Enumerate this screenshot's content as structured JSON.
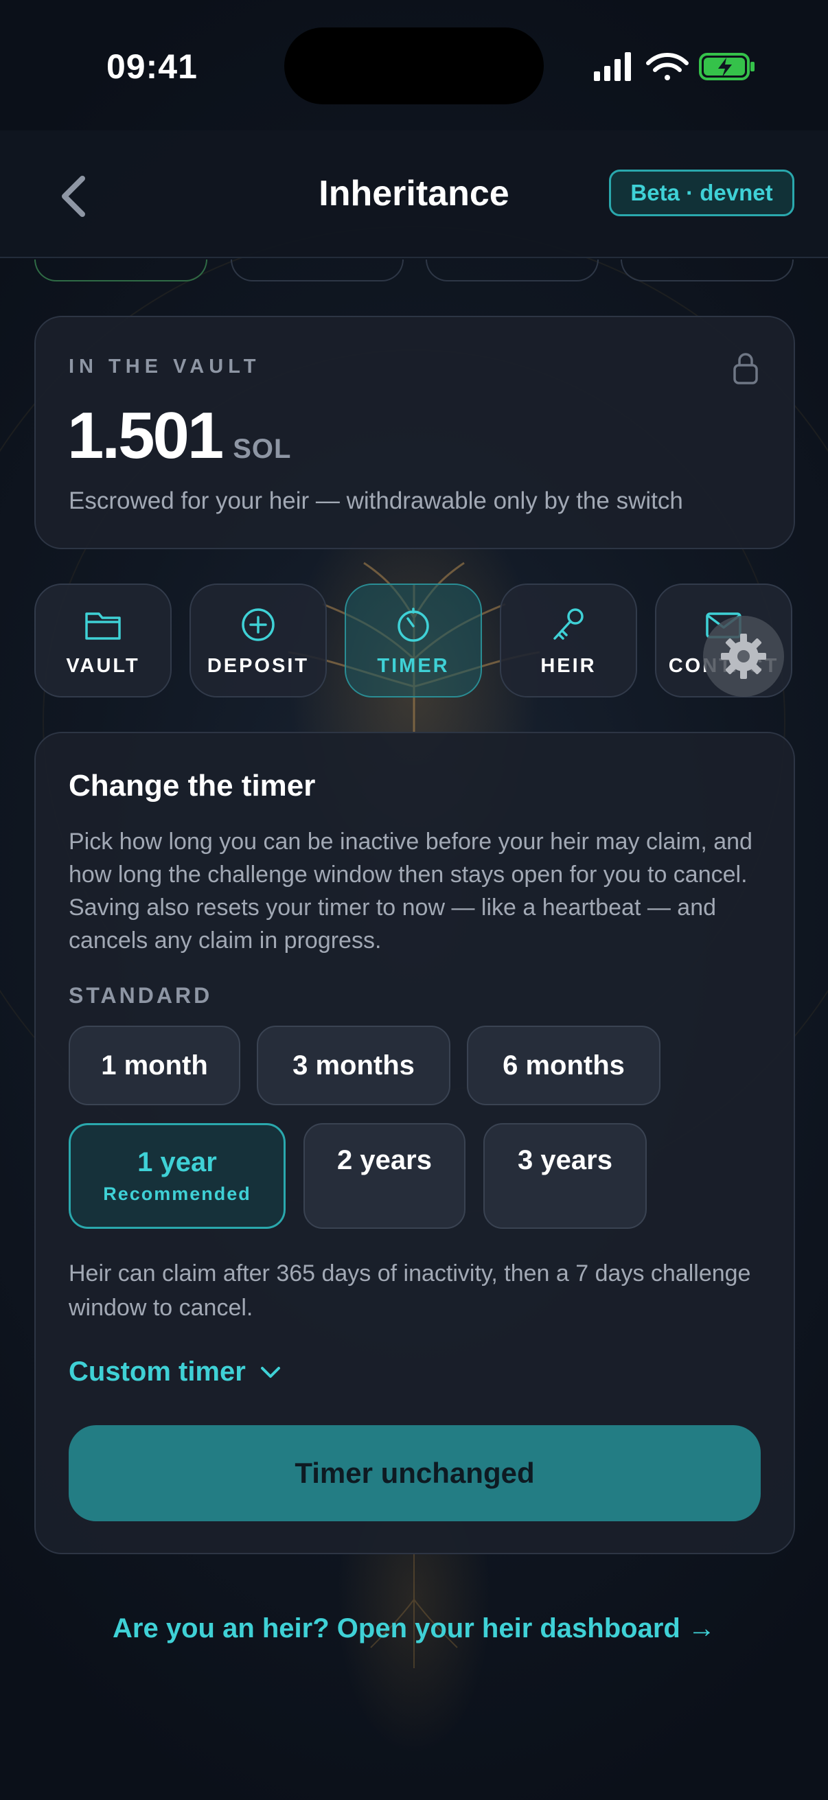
{
  "status_bar": {
    "time": "09:41"
  },
  "header": {
    "title": "Inheritance",
    "badge": "Beta · devnet"
  },
  "vault": {
    "kicker": "IN THE VAULT",
    "amount": "1.501",
    "unit": "SOL",
    "description": "Escrowed for your heir — withdrawable only by the switch"
  },
  "nav": {
    "items": [
      {
        "label": "VAULT",
        "icon": "folder-icon"
      },
      {
        "label": "DEPOSIT",
        "icon": "plus-circle-icon"
      },
      {
        "label": "TIMER",
        "icon": "timer-icon",
        "active": true
      },
      {
        "label": "HEIR",
        "icon": "key-icon"
      },
      {
        "label": "CONTACT",
        "icon": "mail-icon"
      }
    ]
  },
  "timer": {
    "title": "Change the timer",
    "description": "Pick how long you can be inactive before your heir may claim, and how long the challenge window then stays open for you to cancel. Saving also resets your timer to now — like a heartbeat — and cancels any claim in progress.",
    "section_label": "STANDARD",
    "options": [
      {
        "label": "1 month"
      },
      {
        "label": "3 months"
      },
      {
        "label": "6 months"
      },
      {
        "label": "1 year",
        "sublabel": "Recommended",
        "selected": true
      },
      {
        "label": "2 years"
      },
      {
        "label": "3 years"
      }
    ],
    "info": "Heir can claim after 365 days of inactivity, then a 7 days challenge window to cancel.",
    "custom_label": "Custom timer",
    "button_label": "Timer unchanged"
  },
  "footer": {
    "heir_link": "Are you an heir? Open your heir dashboard →"
  },
  "colors": {
    "accent": "#3fd1d6",
    "button": "#237d84",
    "card": "#1a1f2a",
    "background": "#0f1520"
  }
}
